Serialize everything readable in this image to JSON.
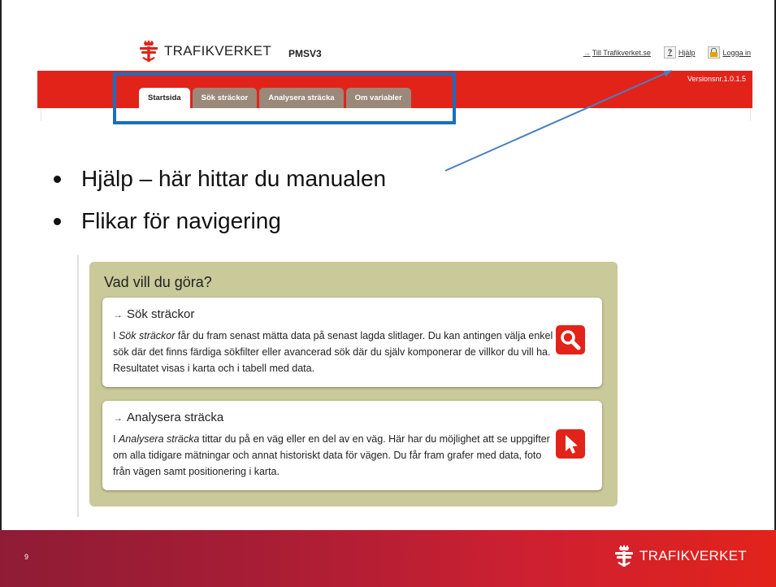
{
  "pms": {
    "brand": "TRAFIKVERKET",
    "app_name": "PMSV3",
    "links": {
      "trafikverket": "Till Trafikverket.se",
      "help": "Hjälp",
      "login": "Logga in"
    },
    "version": "Versionsnr.1.0.1.5",
    "tabs": [
      {
        "label": "Startsida"
      },
      {
        "label": "Sök sträckor"
      },
      {
        "label": "Analysera sträcka"
      },
      {
        "label": "Om variabler"
      }
    ]
  },
  "bullets": [
    "Hjälp – här hittar du manualen",
    "Flikar för navigering"
  ],
  "panel": {
    "title": "Vad vill du göra?",
    "cards": [
      {
        "heading": "Sök sträckor",
        "body_emph": "Sök sträckor",
        "body_rest": " får du fram senast mätta data på senast lagda slitlager. Du kan antingen välja enkel sök där det finns färdiga sökfilter eller avancerad sök där du själv komponerar de villkor du vill ha. Resultatet visas i karta och i tabell med data.",
        "icon": "magnifier-icon"
      },
      {
        "heading": "Analysera sträcka",
        "body_emph": "Analysera sträcka",
        "body_rest": " tittar du på en väg eller en del av en väg. Här har du möjlighet att se uppgifter om alla tidigare mätningar och annat historiskt data för vägen. Du får fram grafer med data, foto från vägen samt positionering i karta.",
        "icon": "cursor-icon"
      }
    ],
    "body_prefix": "I "
  },
  "footer": {
    "page_number": "9",
    "brand": "TRAFIKVERKET"
  },
  "colors": {
    "brand_red": "#e2231a",
    "highlight_blue": "#1a6ec1",
    "panel_olive": "#c9c99a",
    "tab_inactive": "#9a8878"
  }
}
